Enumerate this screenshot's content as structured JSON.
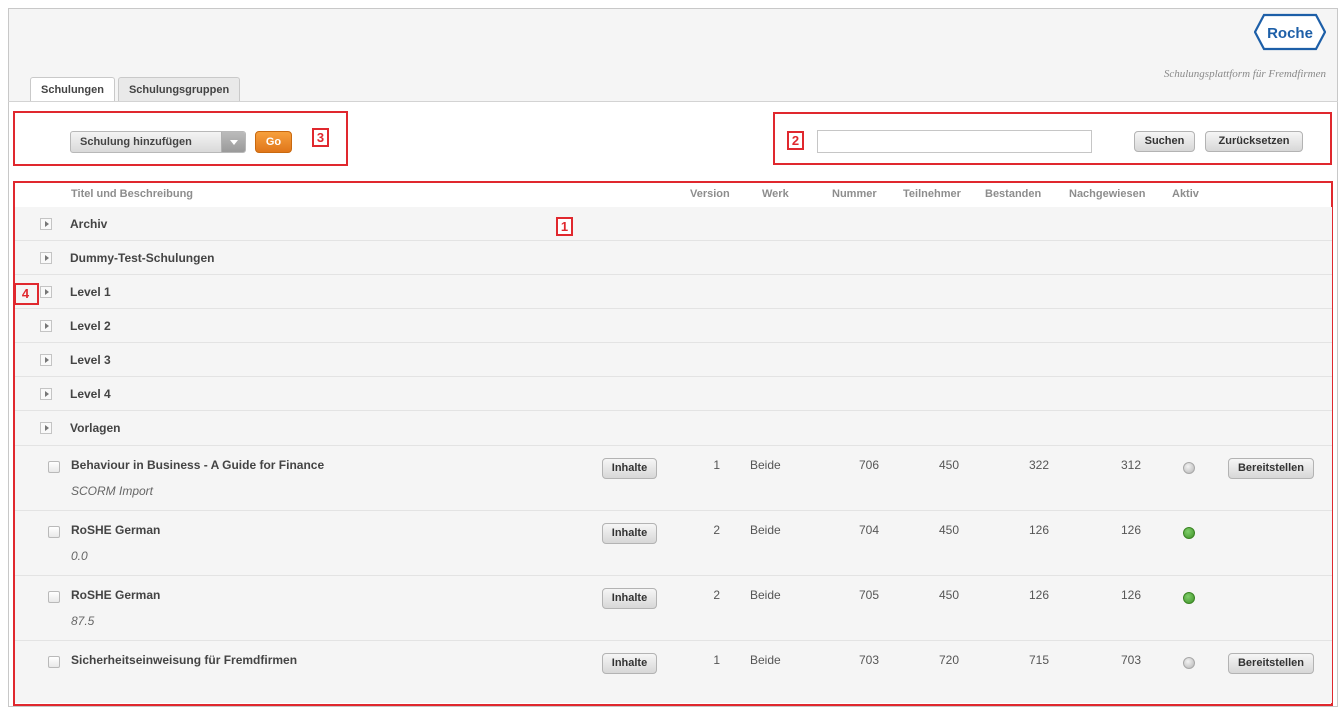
{
  "brand": {
    "logo_text": "Roche",
    "subtitle": "Schulungsplattform für Fremdfirmen"
  },
  "tabs": [
    {
      "label": "Schulungen",
      "active": true
    },
    {
      "label": "Schulungsgruppen",
      "active": false
    }
  ],
  "toolbar": {
    "add_select_value": "Schulung hinzufügen",
    "go_label": "Go",
    "search_placeholder": "",
    "search_label": "Suchen",
    "reset_label": "Zurücksetzen"
  },
  "markers": {
    "m1": "1",
    "m2": "2",
    "m3": "3",
    "m4": "4"
  },
  "table": {
    "headers": {
      "title": "Titel und Beschreibung",
      "version": "Version",
      "werk": "Werk",
      "nummer": "Nummer",
      "teilnehmer": "Teilnehmer",
      "bestanden": "Bestanden",
      "nachgewiesen": "Nachgewiesen",
      "aktiv": "Aktiv"
    },
    "groups": [
      "Archiv",
      "Dummy-Test-Schulungen",
      "Level 1",
      "Level 2",
      "Level 3",
      "Level 4",
      "Vorlagen"
    ],
    "items": [
      {
        "title": "Behaviour in Business - A Guide for Finance",
        "desc": "SCORM Import",
        "content_label": "Inhalte",
        "version": "1",
        "werk": "Beide",
        "nummer": "706",
        "teilnehmer": "450",
        "bestanden": "322",
        "nachgewiesen": "312",
        "aktiv": false,
        "action_label": "Bereitstellen"
      },
      {
        "title": "RoSHE German",
        "desc": "0.0",
        "content_label": "Inhalte",
        "version": "2",
        "werk": "Beide",
        "nummer": "704",
        "teilnehmer": "450",
        "bestanden": "126",
        "nachgewiesen": "126",
        "aktiv": true,
        "action_label": ""
      },
      {
        "title": "RoSHE German",
        "desc": "87.5",
        "content_label": "Inhalte",
        "version": "2",
        "werk": "Beide",
        "nummer": "705",
        "teilnehmer": "450",
        "bestanden": "126",
        "nachgewiesen": "126",
        "aktiv": true,
        "action_label": ""
      },
      {
        "title": "Sicherheitseinweisung für Fremdfirmen",
        "desc": "",
        "content_label": "Inhalte",
        "version": "1",
        "werk": "Beide",
        "nummer": "703",
        "teilnehmer": "720",
        "bestanden": "715",
        "nachgewiesen": "703",
        "aktiv": false,
        "action_label": "Bereitstellen"
      }
    ]
  },
  "colors": {
    "annotation": "#e0282e",
    "go_button": "#ef8a28",
    "active_dot": "#4aa033",
    "inactive_dot": "#c4c4c4",
    "brand_blue": "#1d5fa8"
  }
}
